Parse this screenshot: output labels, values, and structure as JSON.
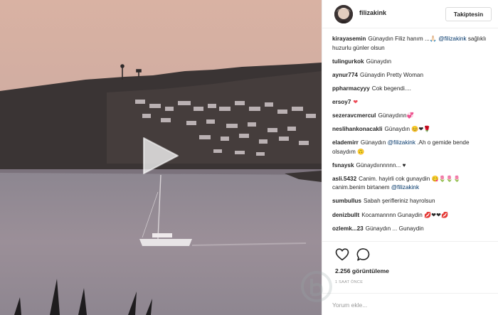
{
  "post": {
    "username": "filizakink",
    "follow_label": "Takiptesin",
    "views_text": "2.256 görüntüleme",
    "time_text": "1 SAAT ÖNCE",
    "comment_placeholder": "Yorum ekle..."
  },
  "icons": {
    "play": "play-icon",
    "like": "heart-outline-icon",
    "comment": "speech-bubble-icon"
  },
  "colors": {
    "mention": "#003569",
    "heart": "#ed4956",
    "muted": "#999999",
    "border": "#efefef"
  },
  "comments": [
    {
      "user": "kirayasemin",
      "text": "Günaydın Filiz hanım ...🙏🏻",
      "mention": "@filizakink",
      "text2": "sağlıklı huzurlu günler olsun"
    },
    {
      "user": "tulingurkok",
      "text": "Günaydın"
    },
    {
      "user": "aynur774",
      "text": "Günaydin Pretty Woman"
    },
    {
      "user": "ppharmacyyy",
      "text": "Cok begendi...."
    },
    {
      "user": "ersoy7",
      "text": "",
      "emoji": "❤"
    },
    {
      "user": "sezeravcmercul",
      "text": "Günaydınn💞"
    },
    {
      "user": "neslihankonacakli",
      "text": "Günaydın 😊❤🌹"
    },
    {
      "user": "elademirr",
      "text": "Günaydın",
      "mention": "@filizakink",
      "text2": ".Ah o gemide bende olsaydım 🙃"
    },
    {
      "user": "fsnaysk",
      "text": "Günaydıınnnnn... ♥"
    },
    {
      "user": "asli.5432",
      "text": "Canim. hayirli cok gunaydin 😋🌷🌷🌷canim.benim birtanem",
      "mention": "@filizakink"
    },
    {
      "user": "sumbullus",
      "text": "Sabah şerifleriniz hayrolsun"
    },
    {
      "user": "denizbullt",
      "text": "Kocamannnn Gunaydin 💋❤❤💋"
    },
    {
      "user": "ozlemk...23",
      "text": "Günaydın ... Gunaydin"
    }
  ]
}
